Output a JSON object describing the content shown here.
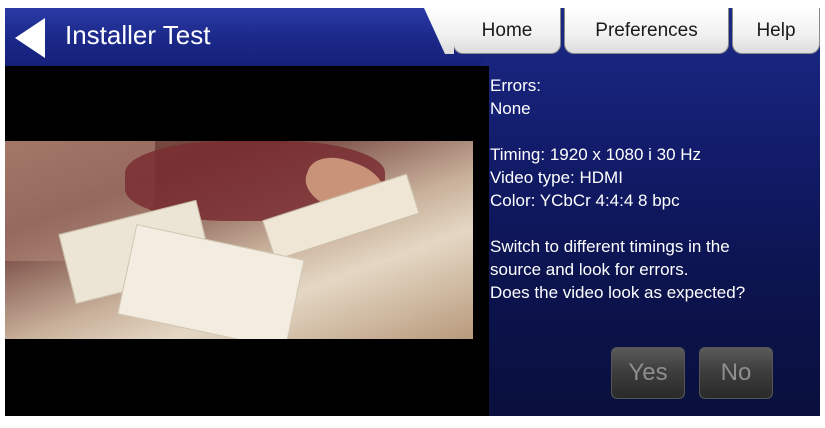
{
  "header": {
    "title": "Installer Test",
    "back_icon": "back-arrow-icon"
  },
  "tabs": [
    {
      "label": "Home"
    },
    {
      "label": "Preferences"
    },
    {
      "label": "Help"
    }
  ],
  "info": {
    "errors_label": "Errors:",
    "errors_value": "None",
    "timing": "Timing: 1920 x 1080 i 30 Hz",
    "video_type": "Video type: HDMI",
    "color": "Color: YCbCr 4:4:4 8 bpc",
    "instruction_1": "Switch to different timings in the",
    "instruction_2": "source and look for errors.",
    "question": "Does the video look as expected?"
  },
  "buttons": {
    "yes": "Yes",
    "no": "No"
  },
  "colors": {
    "background": "#121c6a",
    "header": "#1b2888",
    "tab": "#f0f0f0",
    "button": "#3e3e3e"
  }
}
